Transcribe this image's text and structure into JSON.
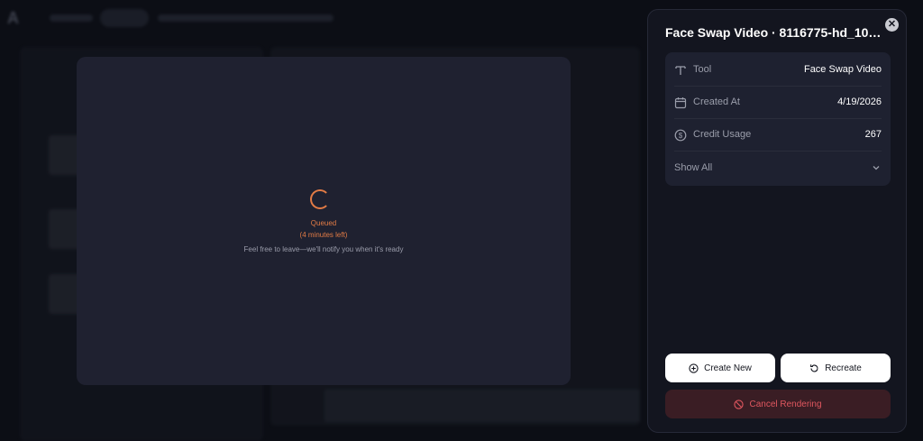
{
  "modal": {
    "status": "Queued",
    "time_left": "(4 minutes left)",
    "notify_message": "Feel free to leave—we'll notify you when it's ready"
  },
  "details_panel": {
    "title": "Face Swap Video · 8116775-hd_1080...",
    "rows": [
      {
        "icon": "text-icon",
        "label": "Tool",
        "value": "Face Swap Video"
      },
      {
        "icon": "calendar-icon",
        "label": "Created At",
        "value": "4/19/2026"
      },
      {
        "icon": "dollar-coin-icon",
        "label": "Credit Usage",
        "value": "267"
      }
    ],
    "show_all_label": "Show All",
    "buttons": {
      "create_new": "Create New",
      "recreate": "Recreate",
      "cancel_rendering": "Cancel Rendering"
    }
  },
  "colors": {
    "accent_orange": "#e27b45",
    "panel_bg": "#13151f",
    "modal_bg": "#1f2130",
    "cancel_text": "#e0575f",
    "cancel_bg": "#3a1d24"
  }
}
